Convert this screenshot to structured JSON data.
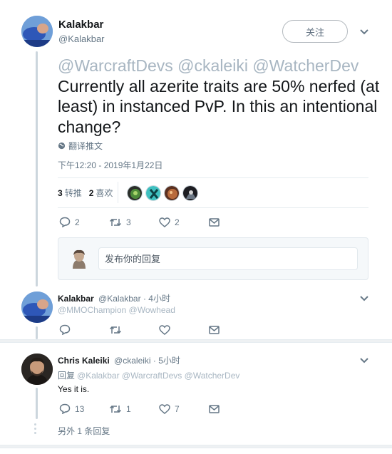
{
  "main_tweet": {
    "author_name": "Kalakbar",
    "author_handle": "@Kalakbar",
    "follow_label": "关注",
    "mentions": "@WarcraftDevs @ckaleiki @WatcherDev",
    "text": "Currently all azerite traits are 50% nerfed (at least) in instanced PvP.  In this an intentional change?",
    "translate_label": "翻译推文",
    "timestamp": "下午12:20 - 2019年1月22日",
    "retweets_count": "3",
    "retweets_label": "转推",
    "likes_count": "2",
    "likes_label": "喜欢",
    "actions": {
      "reply_count": "2",
      "retweet_count": "3",
      "like_count": "2"
    }
  },
  "reply_box": {
    "placeholder": "发布你的回复"
  },
  "replies": [
    {
      "author_name": "Kalakbar",
      "author_handle": "@Kalakbar",
      "time": "· 4小时",
      "mentions": "@MMOChampion @Wowhead",
      "actions": {
        "reply_count": "",
        "retweet_count": "",
        "like_count": ""
      }
    },
    {
      "author_name": "Chris Kaleiki",
      "author_handle": "@ckaleiki",
      "time": "· 5小时",
      "reply_to_label": "回复",
      "mentions": "@Kalakbar @WarcraftDevs @WatcherDev",
      "text": "Yes it is.",
      "actions": {
        "reply_count": "13",
        "retweet_count": "1",
        "like_count": "7"
      }
    }
  ],
  "more_replies_label": "另外 1 条回复",
  "colors": {
    "accent_gray": "#657786",
    "mention_gray": "#a8b6c2",
    "border": "#e6ecf0"
  },
  "icons": [
    "chevron-down-icon",
    "globe-icon",
    "reply-icon",
    "retweet-icon",
    "heart-icon",
    "mail-icon"
  ]
}
